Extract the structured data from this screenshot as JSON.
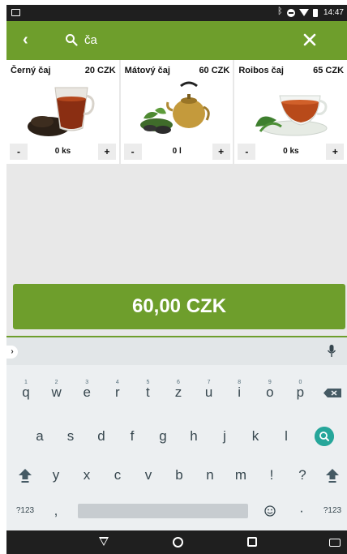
{
  "status": {
    "time": "14:47"
  },
  "search": {
    "query": "ča"
  },
  "products": [
    {
      "name": "Černý čaj",
      "price": "20 CZK",
      "qty": "0 ks"
    },
    {
      "name": "Mátový čaj",
      "price": "60 CZK",
      "qty": "0 l"
    },
    {
      "name": "Roibos čaj",
      "price": "65 CZK",
      "qty": "0 ks"
    }
  ],
  "controls": {
    "minus": "-",
    "plus": "+"
  },
  "total": {
    "label": "60,00 CZK"
  },
  "keyboard": {
    "row1": [
      "q",
      "w",
      "e",
      "r",
      "t",
      "z",
      "u",
      "i",
      "o",
      "p"
    ],
    "row1_hints": [
      "1",
      "2",
      "3",
      "4",
      "5",
      "6",
      "7",
      "8",
      "9",
      "0"
    ],
    "row2": [
      "a",
      "s",
      "d",
      "f",
      "g",
      "h",
      "j",
      "k",
      "l"
    ],
    "row3": [
      "y",
      "x",
      "c",
      "v",
      "b",
      "n",
      "m",
      "!",
      "?"
    ],
    "row4": {
      "symbols": "?123",
      "comma": ",",
      "period": "·",
      "symbols_right": "?123"
    }
  },
  "colors": {
    "accent": "#6e9e2c",
    "search_key": "#26a69a"
  }
}
